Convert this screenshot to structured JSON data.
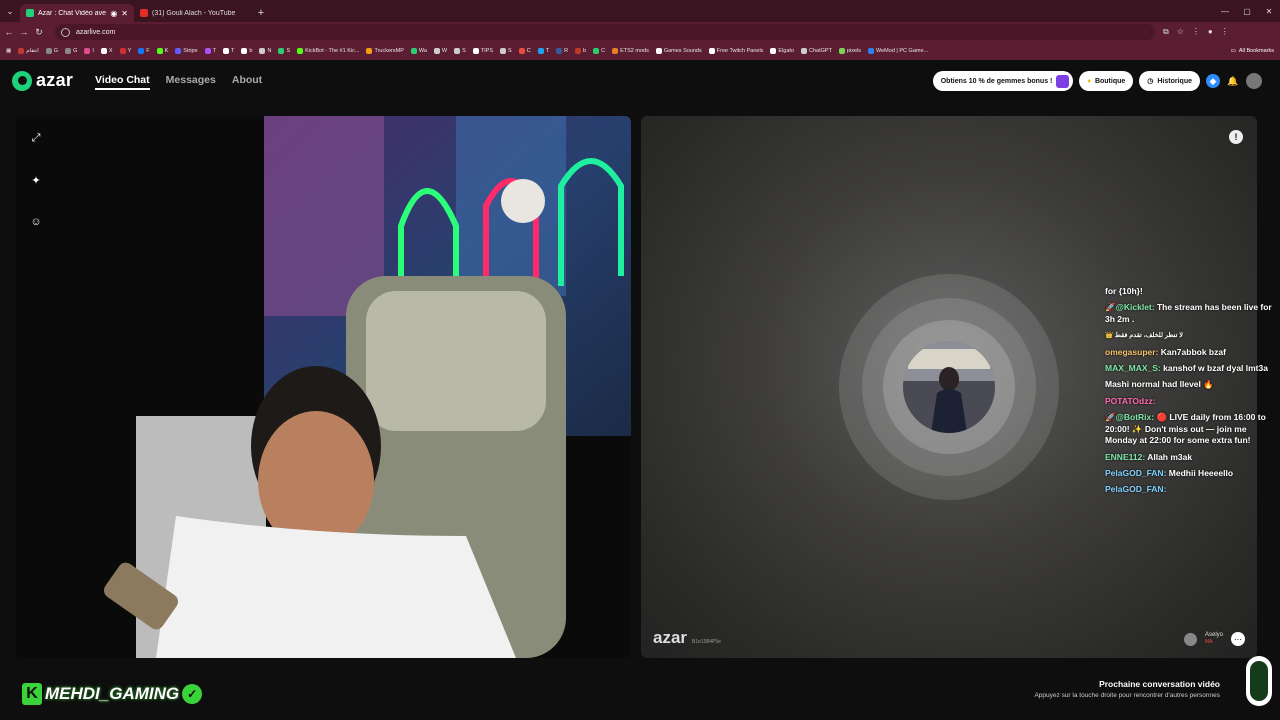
{
  "browser": {
    "tabs": [
      {
        "title": "Azar : Chat Vidéo avec de",
        "active": true
      },
      {
        "title": "(31) Gouli Alach - YouTube",
        "active": false
      }
    ],
    "url": "azarlive.com",
    "bookmarks": [
      "انتقام",
      "G",
      "G",
      "I",
      "X",
      "Y",
      "F",
      "K",
      "Stripe",
      "T",
      "T",
      "b",
      "N",
      "S",
      "KickBot - The #1 Kic...",
      "TruckersMP",
      "Wa",
      "W",
      "S",
      "TIPS",
      "S",
      "C",
      "T",
      "R",
      "b",
      "C",
      "ETS2 mods",
      "Games Sounds",
      "Free Twitch Panels",
      "Elgato",
      "ChatGPT",
      "pixels",
      "WeMod | PC Game..."
    ],
    "all_bookmarks": "All Bookmarks"
  },
  "site": {
    "logo": "azar",
    "nav": {
      "video_chat": "Video Chat",
      "messages": "Messages",
      "about": "About"
    },
    "promo": "Obtiens 10 % de gemmes bonus !",
    "shop": "Boutique",
    "history": "Historique"
  },
  "remote": {
    "watermark": "azar",
    "watermark_id": "B1e1984P5e",
    "user_label": "Aselyo",
    "user_sub": "MA"
  },
  "chat": [
    {
      "user": "",
      "text": "for {10h}!"
    },
    {
      "user": "🚀@Kicklet:",
      "text": "The stream has been live for 3h 2m ."
    },
    {
      "user": "👑",
      "text": "لا تنظر للخلف، تقدم فقط"
    },
    {
      "user": "omegasuper:",
      "text": "Kan7abbok bzaf"
    },
    {
      "user": "MAX_MAX_S:",
      "text": "kanshof w bzaf dyal lmt3a"
    },
    {
      "user": "",
      "text": "Mashi normal had llevel 🔥"
    },
    {
      "user": "POTATOdzz:",
      "text": ""
    },
    {
      "user": "🚀@BotRix:",
      "text": "🔴 LIVE daily from 16:00 to 20:00! ✨ Don't miss out — join me Monday at 22:00 for some extra fun!"
    },
    {
      "user": "ENNE112:",
      "text": "Allah m3ak"
    },
    {
      "user": "PelaGOD_FAN:",
      "text": "Medhii Heeeello"
    },
    {
      "user": "PelaGOD_FAN:",
      "text": ""
    }
  ],
  "streamer_badge": "MEHDI_GAMING",
  "next_conv": {
    "title": "Prochaine conversation vidéo",
    "hint": "Appuyez sur la touche droite pour rencontrer d'autres personnes"
  },
  "colors": {
    "brand": "#1fd27a",
    "tab_bg": "#3b1421",
    "toolbar_bg": "#5a1d31"
  }
}
